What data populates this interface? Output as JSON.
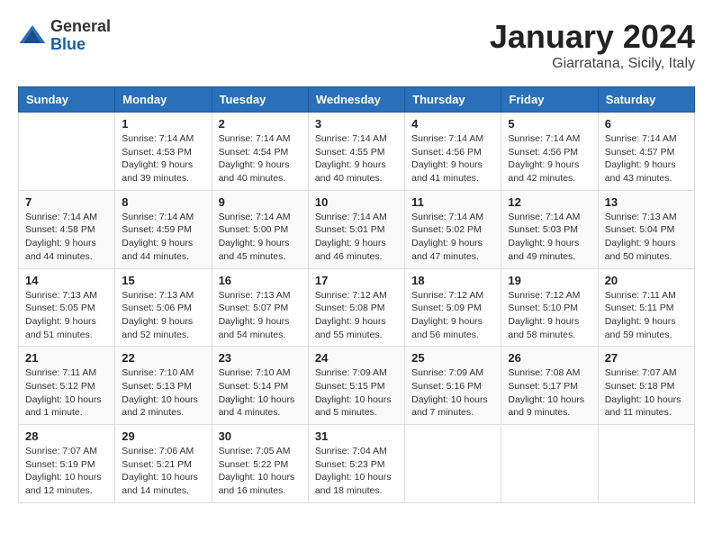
{
  "header": {
    "logo_general": "General",
    "logo_blue": "Blue",
    "month_title": "January 2024",
    "location": "Giarratana, Sicily, Italy"
  },
  "weekdays": [
    "Sunday",
    "Monday",
    "Tuesday",
    "Wednesday",
    "Thursday",
    "Friday",
    "Saturday"
  ],
  "weeks": [
    [
      {
        "day": "",
        "info": ""
      },
      {
        "day": "1",
        "info": "Sunrise: 7:14 AM\nSunset: 4:53 PM\nDaylight: 9 hours\nand 39 minutes."
      },
      {
        "day": "2",
        "info": "Sunrise: 7:14 AM\nSunset: 4:54 PM\nDaylight: 9 hours\nand 40 minutes."
      },
      {
        "day": "3",
        "info": "Sunrise: 7:14 AM\nSunset: 4:55 PM\nDaylight: 9 hours\nand 40 minutes."
      },
      {
        "day": "4",
        "info": "Sunrise: 7:14 AM\nSunset: 4:56 PM\nDaylight: 9 hours\nand 41 minutes."
      },
      {
        "day": "5",
        "info": "Sunrise: 7:14 AM\nSunset: 4:56 PM\nDaylight: 9 hours\nand 42 minutes."
      },
      {
        "day": "6",
        "info": "Sunrise: 7:14 AM\nSunset: 4:57 PM\nDaylight: 9 hours\nand 43 minutes."
      }
    ],
    [
      {
        "day": "7",
        "info": "Sunrise: 7:14 AM\nSunset: 4:58 PM\nDaylight: 9 hours\nand 44 minutes."
      },
      {
        "day": "8",
        "info": "Sunrise: 7:14 AM\nSunset: 4:59 PM\nDaylight: 9 hours\nand 44 minutes."
      },
      {
        "day": "9",
        "info": "Sunrise: 7:14 AM\nSunset: 5:00 PM\nDaylight: 9 hours\nand 45 minutes."
      },
      {
        "day": "10",
        "info": "Sunrise: 7:14 AM\nSunset: 5:01 PM\nDaylight: 9 hours\nand 46 minutes."
      },
      {
        "day": "11",
        "info": "Sunrise: 7:14 AM\nSunset: 5:02 PM\nDaylight: 9 hours\nand 47 minutes."
      },
      {
        "day": "12",
        "info": "Sunrise: 7:14 AM\nSunset: 5:03 PM\nDaylight: 9 hours\nand 49 minutes."
      },
      {
        "day": "13",
        "info": "Sunrise: 7:13 AM\nSunset: 5:04 PM\nDaylight: 9 hours\nand 50 minutes."
      }
    ],
    [
      {
        "day": "14",
        "info": "Sunrise: 7:13 AM\nSunset: 5:05 PM\nDaylight: 9 hours\nand 51 minutes."
      },
      {
        "day": "15",
        "info": "Sunrise: 7:13 AM\nSunset: 5:06 PM\nDaylight: 9 hours\nand 52 minutes."
      },
      {
        "day": "16",
        "info": "Sunrise: 7:13 AM\nSunset: 5:07 PM\nDaylight: 9 hours\nand 54 minutes."
      },
      {
        "day": "17",
        "info": "Sunrise: 7:12 AM\nSunset: 5:08 PM\nDaylight: 9 hours\nand 55 minutes."
      },
      {
        "day": "18",
        "info": "Sunrise: 7:12 AM\nSunset: 5:09 PM\nDaylight: 9 hours\nand 56 minutes."
      },
      {
        "day": "19",
        "info": "Sunrise: 7:12 AM\nSunset: 5:10 PM\nDaylight: 9 hours\nand 58 minutes."
      },
      {
        "day": "20",
        "info": "Sunrise: 7:11 AM\nSunset: 5:11 PM\nDaylight: 9 hours\nand 59 minutes."
      }
    ],
    [
      {
        "day": "21",
        "info": "Sunrise: 7:11 AM\nSunset: 5:12 PM\nDaylight: 10 hours\nand 1 minute."
      },
      {
        "day": "22",
        "info": "Sunrise: 7:10 AM\nSunset: 5:13 PM\nDaylight: 10 hours\nand 2 minutes."
      },
      {
        "day": "23",
        "info": "Sunrise: 7:10 AM\nSunset: 5:14 PM\nDaylight: 10 hours\nand 4 minutes."
      },
      {
        "day": "24",
        "info": "Sunrise: 7:09 AM\nSunset: 5:15 PM\nDaylight: 10 hours\nand 5 minutes."
      },
      {
        "day": "25",
        "info": "Sunrise: 7:09 AM\nSunset: 5:16 PM\nDaylight: 10 hours\nand 7 minutes."
      },
      {
        "day": "26",
        "info": "Sunrise: 7:08 AM\nSunset: 5:17 PM\nDaylight: 10 hours\nand 9 minutes."
      },
      {
        "day": "27",
        "info": "Sunrise: 7:07 AM\nSunset: 5:18 PM\nDaylight: 10 hours\nand 11 minutes."
      }
    ],
    [
      {
        "day": "28",
        "info": "Sunrise: 7:07 AM\nSunset: 5:19 PM\nDaylight: 10 hours\nand 12 minutes."
      },
      {
        "day": "29",
        "info": "Sunrise: 7:06 AM\nSunset: 5:21 PM\nDaylight: 10 hours\nand 14 minutes."
      },
      {
        "day": "30",
        "info": "Sunrise: 7:05 AM\nSunset: 5:22 PM\nDaylight: 10 hours\nand 16 minutes."
      },
      {
        "day": "31",
        "info": "Sunrise: 7:04 AM\nSunset: 5:23 PM\nDaylight: 10 hours\nand 18 minutes."
      },
      {
        "day": "",
        "info": ""
      },
      {
        "day": "",
        "info": ""
      },
      {
        "day": "",
        "info": ""
      }
    ]
  ]
}
